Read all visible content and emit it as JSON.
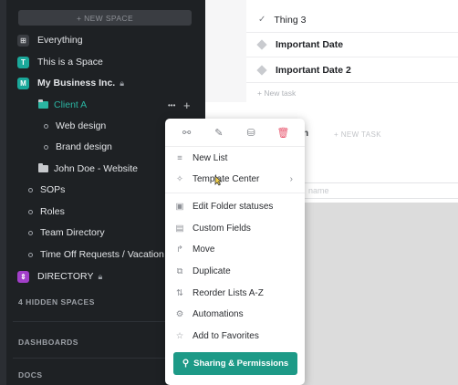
{
  "sidebar": {
    "new_space": "+ NEW SPACE",
    "everything": "Everything",
    "this_is_a_space": "This is a Space",
    "space_letter_t": "T",
    "my_business": "My Business Inc.",
    "space_letter_m": "M",
    "client_a": "Client A",
    "web_design": "Web design",
    "brand_design": "Brand design",
    "john_doe": "John Doe - Website",
    "sops": "SOPs",
    "roles": "Roles",
    "team_directory": "Team Directory",
    "time_off": "Time Off Requests / Vacation ...",
    "directory": "DIRECTORY",
    "hidden_spaces": "4 HIDDEN SPACES",
    "dashboards": "DASHBOARDS",
    "docs": "DOCS",
    "more": "•••",
    "plus": "+"
  },
  "main": {
    "tasks": [
      "Thing 3",
      "Important Date",
      "Important Date 2"
    ],
    "new_task": "+ New task",
    "ghost_letter": "n",
    "ghost_new_task": "+ NEW TASK",
    "ghost_name": "name"
  },
  "menu": {
    "items": [
      "New List",
      "Template Center",
      "Edit Folder statuses",
      "Custom Fields",
      "Move",
      "Duplicate",
      "Reorder Lists A-Z",
      "Automations",
      "Add to Favorites"
    ],
    "share_button": "Sharing & Permissions"
  },
  "colors": {
    "accent_teal": "#1d9a87",
    "space_t": "#1aa89a",
    "space_m": "#1aa89a",
    "directory_purple": "#a23fc9",
    "delete_red": "#e8566e"
  }
}
